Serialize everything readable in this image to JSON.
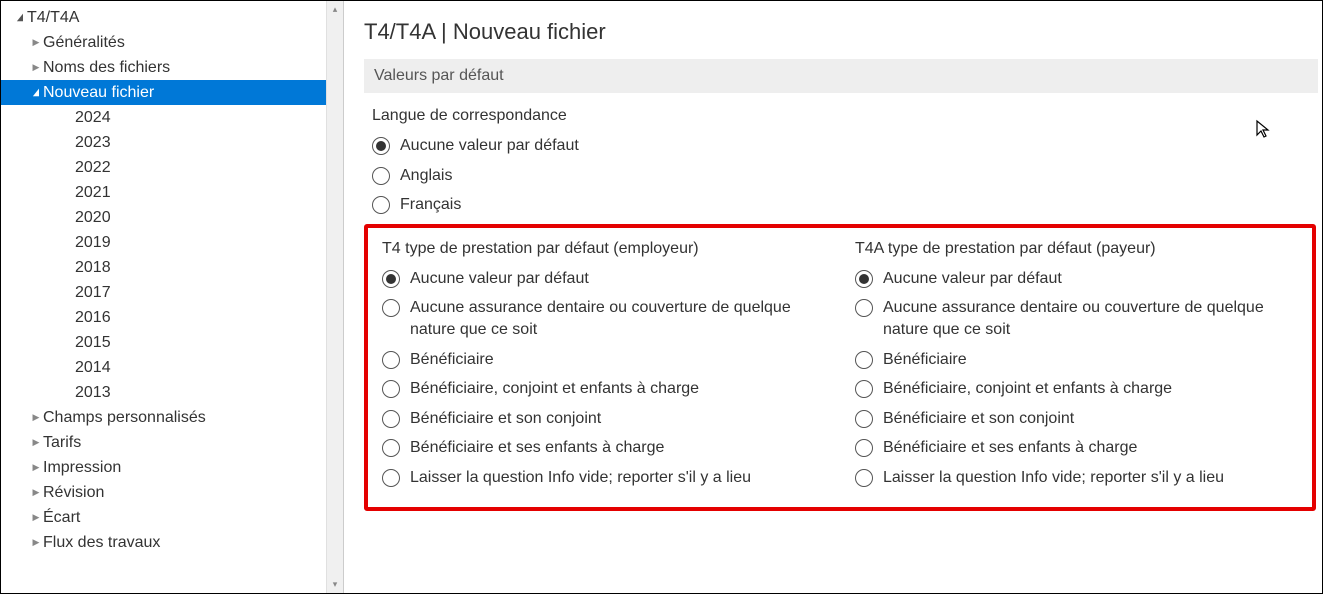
{
  "sidebar": {
    "items": [
      {
        "label": "T4/T4A",
        "indent": 0,
        "caret": "down",
        "selected": false
      },
      {
        "label": "Généralités",
        "indent": 1,
        "caret": "right",
        "selected": false
      },
      {
        "label": "Noms des fichiers",
        "indent": 1,
        "caret": "right",
        "selected": false
      },
      {
        "label": "Nouveau fichier",
        "indent": 1,
        "caret": "down",
        "selected": true
      },
      {
        "label": "2024",
        "indent": 2,
        "caret": "none",
        "selected": false
      },
      {
        "label": "2023",
        "indent": 2,
        "caret": "none",
        "selected": false
      },
      {
        "label": "2022",
        "indent": 2,
        "caret": "none",
        "selected": false
      },
      {
        "label": "2021",
        "indent": 2,
        "caret": "none",
        "selected": false
      },
      {
        "label": "2020",
        "indent": 2,
        "caret": "none",
        "selected": false
      },
      {
        "label": "2019",
        "indent": 2,
        "caret": "none",
        "selected": false
      },
      {
        "label": "2018",
        "indent": 2,
        "caret": "none",
        "selected": false
      },
      {
        "label": "2017",
        "indent": 2,
        "caret": "none",
        "selected": false
      },
      {
        "label": "2016",
        "indent": 2,
        "caret": "none",
        "selected": false
      },
      {
        "label": "2015",
        "indent": 2,
        "caret": "none",
        "selected": false
      },
      {
        "label": "2014",
        "indent": 2,
        "caret": "none",
        "selected": false
      },
      {
        "label": "2013",
        "indent": 2,
        "caret": "none",
        "selected": false
      },
      {
        "label": "Champs personnalisés",
        "indent": 1,
        "caret": "right",
        "selected": false
      },
      {
        "label": "Tarifs",
        "indent": 1,
        "caret": "right",
        "selected": false
      },
      {
        "label": "Impression",
        "indent": 1,
        "caret": "right",
        "selected": false
      },
      {
        "label": "Révision",
        "indent": 1,
        "caret": "right",
        "selected": false
      },
      {
        "label": "Écart",
        "indent": 1,
        "caret": "right",
        "selected": false
      },
      {
        "label": "Flux des travaux",
        "indent": 1,
        "caret": "right",
        "selected": false
      }
    ]
  },
  "main": {
    "title": "T4/T4A | Nouveau fichier",
    "section_header": "Valeurs par défaut",
    "lang_group": {
      "label": "Langue de correspondance",
      "options": [
        {
          "label": "Aucune valeur par défaut",
          "checked": true
        },
        {
          "label": "Anglais",
          "checked": false
        },
        {
          "label": "Français",
          "checked": false
        }
      ]
    },
    "t4_group": {
      "label": "T4 type de prestation par défaut (employeur)",
      "options": [
        {
          "label": "Aucune valeur par défaut",
          "checked": true
        },
        {
          "label": "Aucune assurance dentaire ou couverture de quelque nature que ce soit",
          "checked": false
        },
        {
          "label": "Bénéficiaire",
          "checked": false
        },
        {
          "label": "Bénéficiaire, conjoint et enfants à charge",
          "checked": false
        },
        {
          "label": "Bénéficiaire et son conjoint",
          "checked": false
        },
        {
          "label": "Bénéficiaire et ses enfants à charge",
          "checked": false
        },
        {
          "label": "Laisser la question Info vide; reporter s'il y a lieu",
          "checked": false
        }
      ]
    },
    "t4a_group": {
      "label": "T4A type de prestation par défaut (payeur)",
      "options": [
        {
          "label": "Aucune valeur par défaut",
          "checked": true
        },
        {
          "label": "Aucune assurance dentaire ou couverture de quelque nature que ce soit",
          "checked": false
        },
        {
          "label": "Bénéficiaire",
          "checked": false
        },
        {
          "label": "Bénéficiaire, conjoint et enfants à charge",
          "checked": false
        },
        {
          "label": "Bénéficiaire et son conjoint",
          "checked": false
        },
        {
          "label": "Bénéficiaire et ses enfants à charge",
          "checked": false
        },
        {
          "label": "Laisser la question Info vide; reporter s'il y a lieu",
          "checked": false
        }
      ]
    }
  }
}
